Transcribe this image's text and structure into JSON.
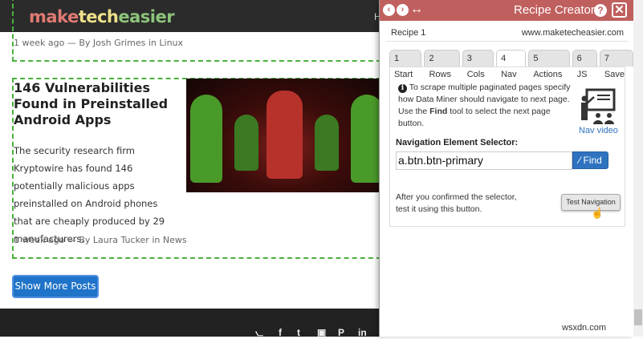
{
  "site": {
    "logo": [
      "make",
      "tech",
      "easier"
    ],
    "nav_partial": "H",
    "posts": [
      {
        "meta": "1 week ago — By Josh Grimes in Linux"
      },
      {
        "title": "146 Vulnerabilities Found in Preinstalled Android Apps",
        "excerpt": "The security research firm Kryptowire has found 146 potentially malicious apps preinstalled on Android phones that are cheaply produced by 29 manufacturers.",
        "meta": "1 week ago — By Laura Tucker in News"
      }
    ],
    "show_more_label": "Show More Posts",
    "social_icons": [
      "rss-icon",
      "facebook-icon",
      "twitter-icon",
      "instagram-icon",
      "pinterest-icon",
      "linkedin-icon"
    ],
    "social_glyphs": [
      "⦦",
      "f",
      "t",
      "▣",
      "P",
      "in"
    ]
  },
  "panel": {
    "title": "Recipe Creator",
    "help": "?",
    "close": "✕",
    "back": "‹",
    "forward": "›",
    "resize": "↔",
    "recipe_name": "Recipe 1",
    "domain": "www.maketecheasier.com",
    "tabs": [
      "1 Start",
      "2 Rows",
      "3 Cols",
      "4 Nav",
      "5 Actions",
      "6 JS",
      "7 Save"
    ],
    "active_tab": "4 Nav",
    "info_pre": "To scrape multiple paginated pages specify how Data Miner should navigate to next page. Use the ",
    "info_bold": "Find",
    "info_post": " tool to select the next page button.",
    "nav_video": "Nav video",
    "selector_label": "Navigation Element Selector:",
    "selector_value": "a.btn.btn-primary",
    "find_label": "Find",
    "after_text": "After you confirmed the selector, test it using this button.",
    "test_button": "Test Navigation",
    "accent": "#c0605e"
  },
  "watermark": "wsxdn.com"
}
